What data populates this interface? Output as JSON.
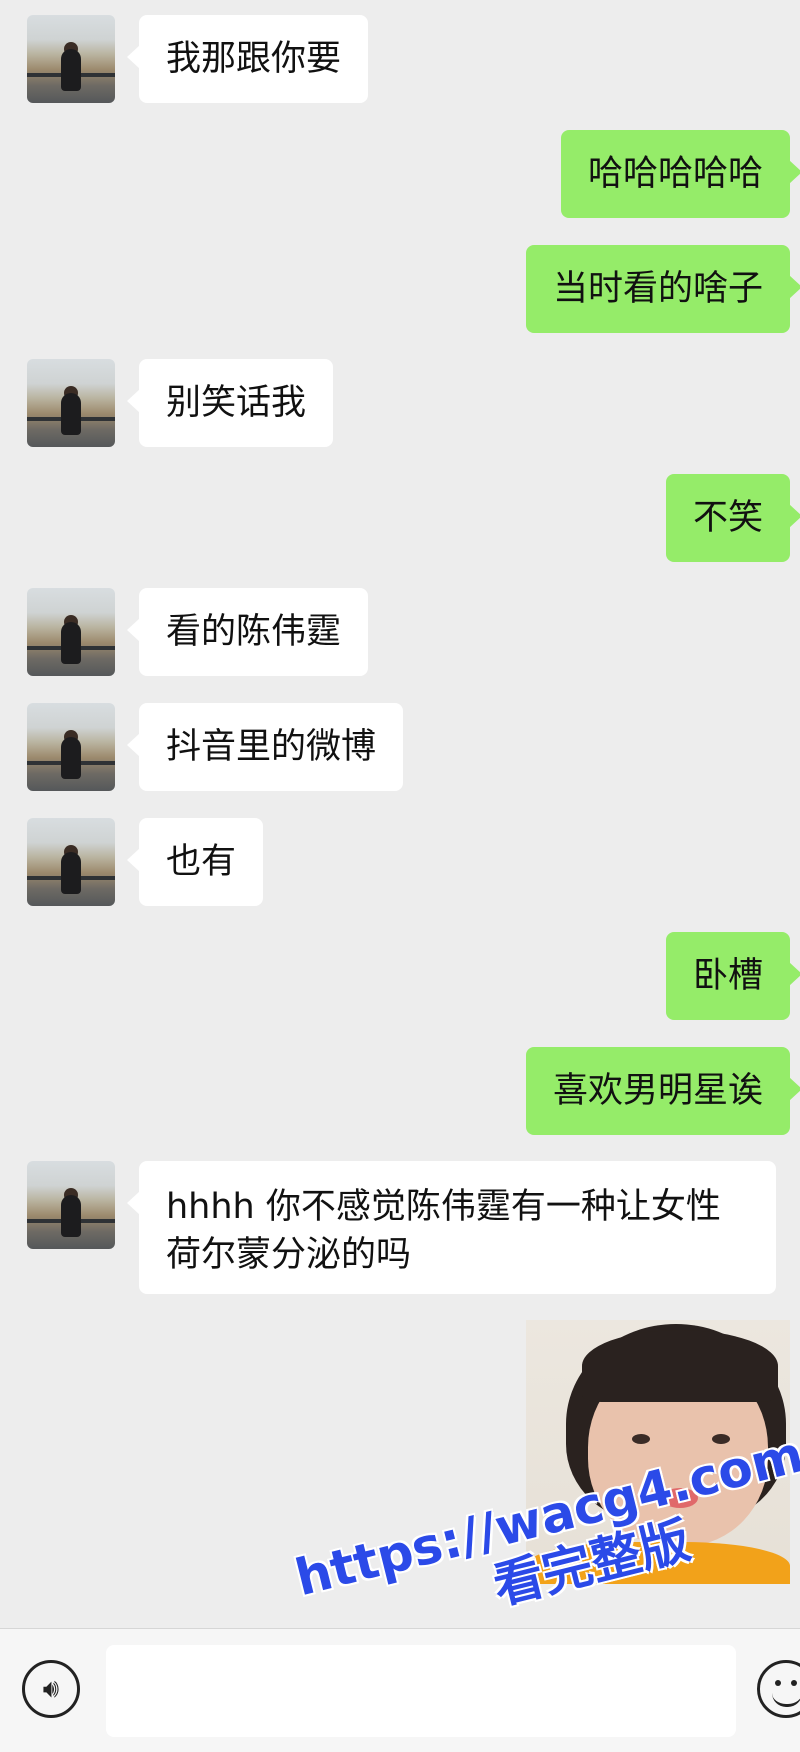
{
  "messages": [
    {
      "side": "in",
      "text": "我那跟你要"
    },
    {
      "side": "out",
      "text": "哈哈哈哈哈"
    },
    {
      "side": "out",
      "text": "当时看的啥子"
    },
    {
      "side": "in",
      "text": "别笑话我"
    },
    {
      "side": "out",
      "text": "不笑"
    },
    {
      "side": "in",
      "text": "看的陈伟霆"
    },
    {
      "side": "in",
      "text": "抖音里的微博"
    },
    {
      "side": "in",
      "text": "也有"
    },
    {
      "side": "out",
      "text": "卧槽"
    },
    {
      "side": "out",
      "text": "喜欢男明星诶"
    },
    {
      "side": "in",
      "text": "hhhh 你不感觉陈伟霆有一种让女性荷尔蒙分泌的吗"
    }
  ],
  "input": {
    "value": "",
    "placeholder": ""
  },
  "icons": {
    "voice": "voice-icon",
    "emoji": "emoji-icon"
  },
  "colors": {
    "background": "#ededed",
    "incoming_bubble": "#ffffff",
    "outgoing_bubble": "#95ec69"
  },
  "watermark": {
    "url": "https://wacg4.com",
    "text": "看完整版"
  }
}
